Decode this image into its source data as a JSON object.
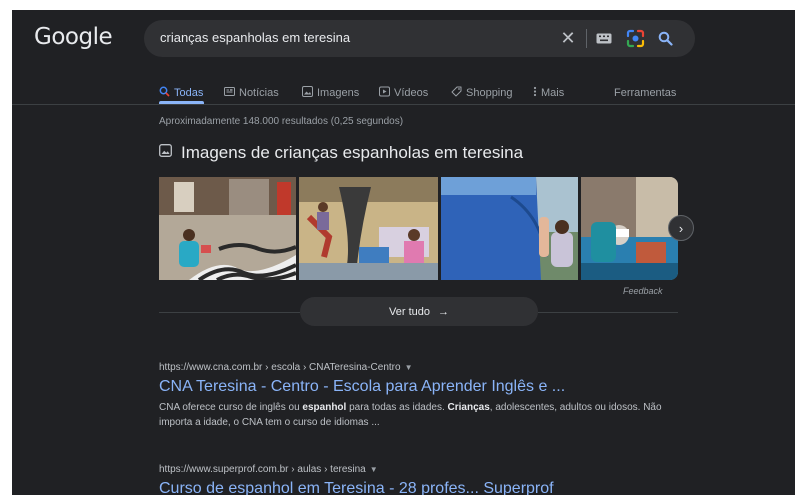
{
  "logo": "Google",
  "search": {
    "query": "crianças espanholas em teresina",
    "clear_icon": "close-icon",
    "keyboard_icon": "keyboard-icon",
    "lens_icon": "camera-lens-icon",
    "submit_icon": "search-icon"
  },
  "tabs": [
    {
      "label": "Todas",
      "icon": "search-icon",
      "active": true
    },
    {
      "label": "Notícias",
      "icon": "news-icon",
      "active": false
    },
    {
      "label": "Imagens",
      "icon": "image-icon",
      "active": false
    },
    {
      "label": "Vídeos",
      "icon": "play-icon",
      "active": false
    },
    {
      "label": "Shopping",
      "icon": "tag-icon",
      "active": false
    },
    {
      "label": "Mais",
      "icon": "more-vert-icon",
      "active": false
    }
  ],
  "tools_label": "Ferramentas",
  "stats": "Aproximadamente 148.000 resultados (0,25 segundos)",
  "images_section": {
    "title": "Imagens de crianças espanholas em teresina",
    "feedback": "Feedback",
    "see_all": "Ver tudo",
    "next_icon": "chevron-right-icon"
  },
  "results": [
    {
      "url": "https://www.cna.com.br › escola › CNATeresina-Centro",
      "title": "CNA Teresina - Centro - Escola para Aprender Inglês e ...",
      "snippet_parts": [
        {
          "text": "CNA oferece curso de inglês ou ",
          "bold": false
        },
        {
          "text": "espanhol",
          "bold": true
        },
        {
          "text": " para todas as idades. ",
          "bold": false
        },
        {
          "text": "Crianças",
          "bold": true
        },
        {
          "text": ", adolescentes, adultos ou idosos. Não importa a idade, o CNA tem o curso de idiomas ...",
          "bold": false
        }
      ]
    },
    {
      "url": "https://www.superprof.com.br › aulas › teresina",
      "title": "Curso de espanhol em Teresina - 28 profes... Superprof"
    }
  ],
  "colors": {
    "background": "#202124",
    "search_bg": "#303134",
    "link": "#8ab4f8",
    "text": "#e8eaed",
    "muted": "#9aa0a6"
  }
}
